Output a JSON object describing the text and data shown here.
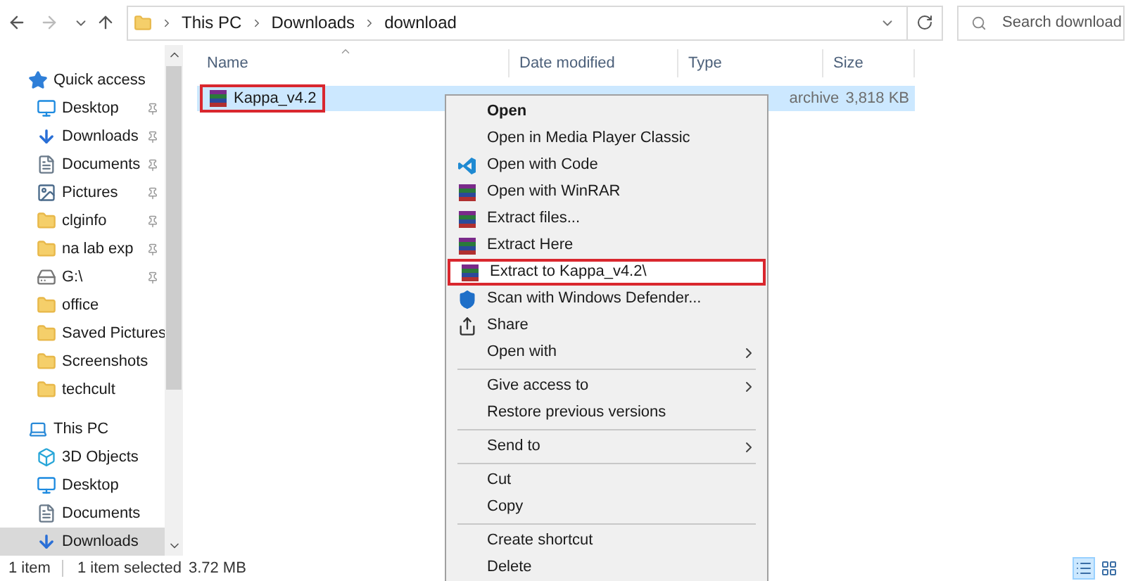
{
  "nav": {
    "breadcrumb": [
      "This PC",
      "Downloads",
      "download"
    ]
  },
  "search": {
    "placeholder": "Search download"
  },
  "sidebar": {
    "items": [
      {
        "kind": "header",
        "label": "Quick access",
        "pinned": false,
        "selected": false
      },
      {
        "kind": "item",
        "label": "Desktop",
        "pinned": true,
        "selected": false
      },
      {
        "kind": "item",
        "label": "Downloads",
        "pinned": true,
        "selected": false
      },
      {
        "kind": "item",
        "label": "Documents",
        "pinned": true,
        "selected": false
      },
      {
        "kind": "item",
        "label": "Pictures",
        "pinned": true,
        "selected": false
      },
      {
        "kind": "item",
        "label": "clginfo",
        "pinned": true,
        "selected": false
      },
      {
        "kind": "item",
        "label": "na lab exp",
        "pinned": true,
        "selected": false
      },
      {
        "kind": "item",
        "label": "G:\\",
        "pinned": true,
        "selected": false
      },
      {
        "kind": "item",
        "label": "office",
        "pinned": false,
        "selected": false
      },
      {
        "kind": "item",
        "label": "Saved Pictures",
        "pinned": false,
        "selected": false
      },
      {
        "kind": "item",
        "label": "Screenshots",
        "pinned": false,
        "selected": false
      },
      {
        "kind": "item",
        "label": "techcult",
        "pinned": false,
        "selected": false
      },
      {
        "kind": "header",
        "label": "This PC",
        "pinned": false,
        "selected": false
      },
      {
        "kind": "item",
        "label": "3D Objects",
        "pinned": false,
        "selected": false
      },
      {
        "kind": "item",
        "label": "Desktop",
        "pinned": false,
        "selected": false
      },
      {
        "kind": "item",
        "label": "Documents",
        "pinned": false,
        "selected": false
      },
      {
        "kind": "item",
        "label": "Downloads",
        "pinned": false,
        "selected": true
      }
    ]
  },
  "table": {
    "columns": [
      "Name",
      "Date modified",
      "Type",
      "Size"
    ],
    "rows": [
      {
        "name": "Kappa_v4.2",
        "type": "archive",
        "size": "3,818 KB",
        "selected": true,
        "highlighted": true
      }
    ]
  },
  "context_menu": {
    "items": [
      {
        "kind": "item",
        "label": "Open",
        "bold": true,
        "submenu": false,
        "highlighted": false
      },
      {
        "kind": "item",
        "label": "Open in Media Player Classic",
        "bold": false,
        "submenu": false,
        "highlighted": false
      },
      {
        "kind": "item",
        "label": "Open with Code",
        "bold": false,
        "submenu": false,
        "highlighted": false
      },
      {
        "kind": "item",
        "label": "Open with WinRAR",
        "bold": false,
        "submenu": false,
        "highlighted": false
      },
      {
        "kind": "item",
        "label": "Extract files...",
        "bold": false,
        "submenu": false,
        "highlighted": false
      },
      {
        "kind": "item",
        "label": "Extract Here",
        "bold": false,
        "submenu": false,
        "highlighted": false
      },
      {
        "kind": "item",
        "label": "Extract to Kappa_v4.2\\",
        "bold": false,
        "submenu": false,
        "highlighted": true
      },
      {
        "kind": "item",
        "label": "Scan with Windows Defender...",
        "bold": false,
        "submenu": false,
        "highlighted": false
      },
      {
        "kind": "item",
        "label": "Share",
        "bold": false,
        "submenu": false,
        "highlighted": false
      },
      {
        "kind": "item",
        "label": "Open with",
        "bold": false,
        "submenu": true,
        "highlighted": false
      },
      {
        "kind": "separator"
      },
      {
        "kind": "item",
        "label": "Give access to",
        "bold": false,
        "submenu": true,
        "highlighted": false
      },
      {
        "kind": "item",
        "label": "Restore previous versions",
        "bold": false,
        "submenu": false,
        "highlighted": false
      },
      {
        "kind": "separator"
      },
      {
        "kind": "item",
        "label": "Send to",
        "bold": false,
        "submenu": true,
        "highlighted": false
      },
      {
        "kind": "separator"
      },
      {
        "kind": "item",
        "label": "Cut",
        "bold": false,
        "submenu": false,
        "highlighted": false
      },
      {
        "kind": "item",
        "label": "Copy",
        "bold": false,
        "submenu": false,
        "highlighted": false
      },
      {
        "kind": "separator"
      },
      {
        "kind": "item",
        "label": "Create shortcut",
        "bold": false,
        "submenu": false,
        "highlighted": false
      },
      {
        "kind": "item",
        "label": "Delete",
        "bold": false,
        "submenu": false,
        "highlighted": false
      }
    ]
  },
  "status_bar": {
    "count": "1 item",
    "selection": "1 item selected",
    "size": "3.72 MB"
  },
  "view_buttons": [
    {
      "kind": "details",
      "selected": true
    },
    {
      "kind": "large_icons",
      "selected": false
    }
  ]
}
